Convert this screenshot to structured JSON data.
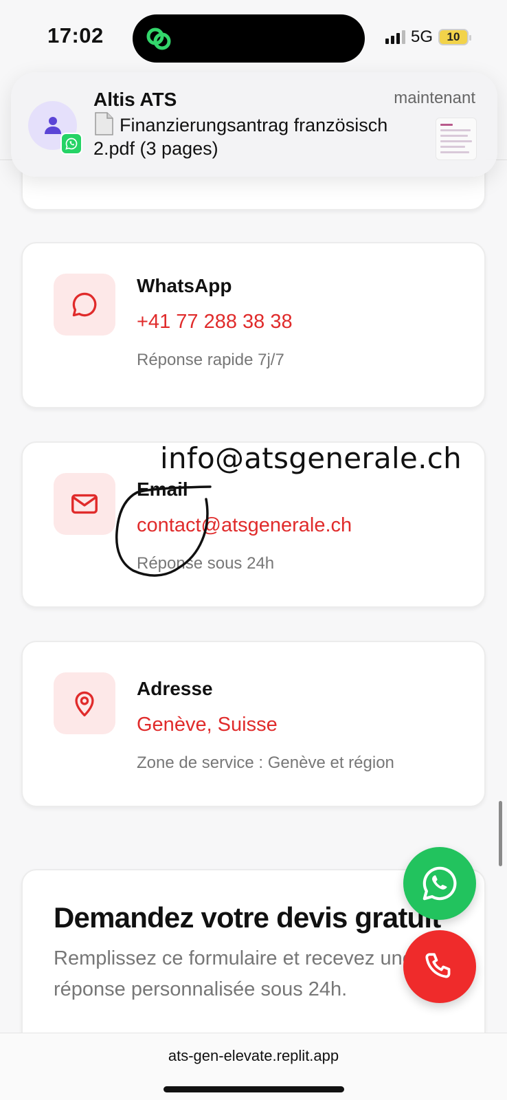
{
  "status_bar": {
    "time": "17:02",
    "network": "5G",
    "battery": "10"
  },
  "notification": {
    "app": "Altis ATS",
    "time": "maintenant",
    "message": "Finanzierungsantrag französisch 2.pdf (3 pages)"
  },
  "contact_cards": [
    {
      "title": "WhatsApp",
      "value": "+41 77 288 38 38",
      "note": "Réponse rapide 7j/7",
      "icon": "chat-bubble-icon"
    },
    {
      "title": "Email",
      "value": "contact@atsgenerale.ch",
      "note": "Réponse sous 24h",
      "icon": "mail-icon"
    },
    {
      "title": "Adresse",
      "value": "Genève, Suisse",
      "note": "Zone de service : Genève et région",
      "icon": "map-pin-icon"
    }
  ],
  "handwritten_annotation": "info@atsgenerale.ch",
  "quote_section": {
    "title": "Demandez votre devis gratuit",
    "subtitle": "Remplissez ce formulaire et recevez une réponse personnalisée sous 24h."
  },
  "browser": {
    "url": "ats-gen-elevate.replit.app"
  },
  "colors": {
    "accent_red": "#e02b2b",
    "icon_tile_bg": "#fde8e8",
    "whatsapp_green": "#22c35e"
  }
}
